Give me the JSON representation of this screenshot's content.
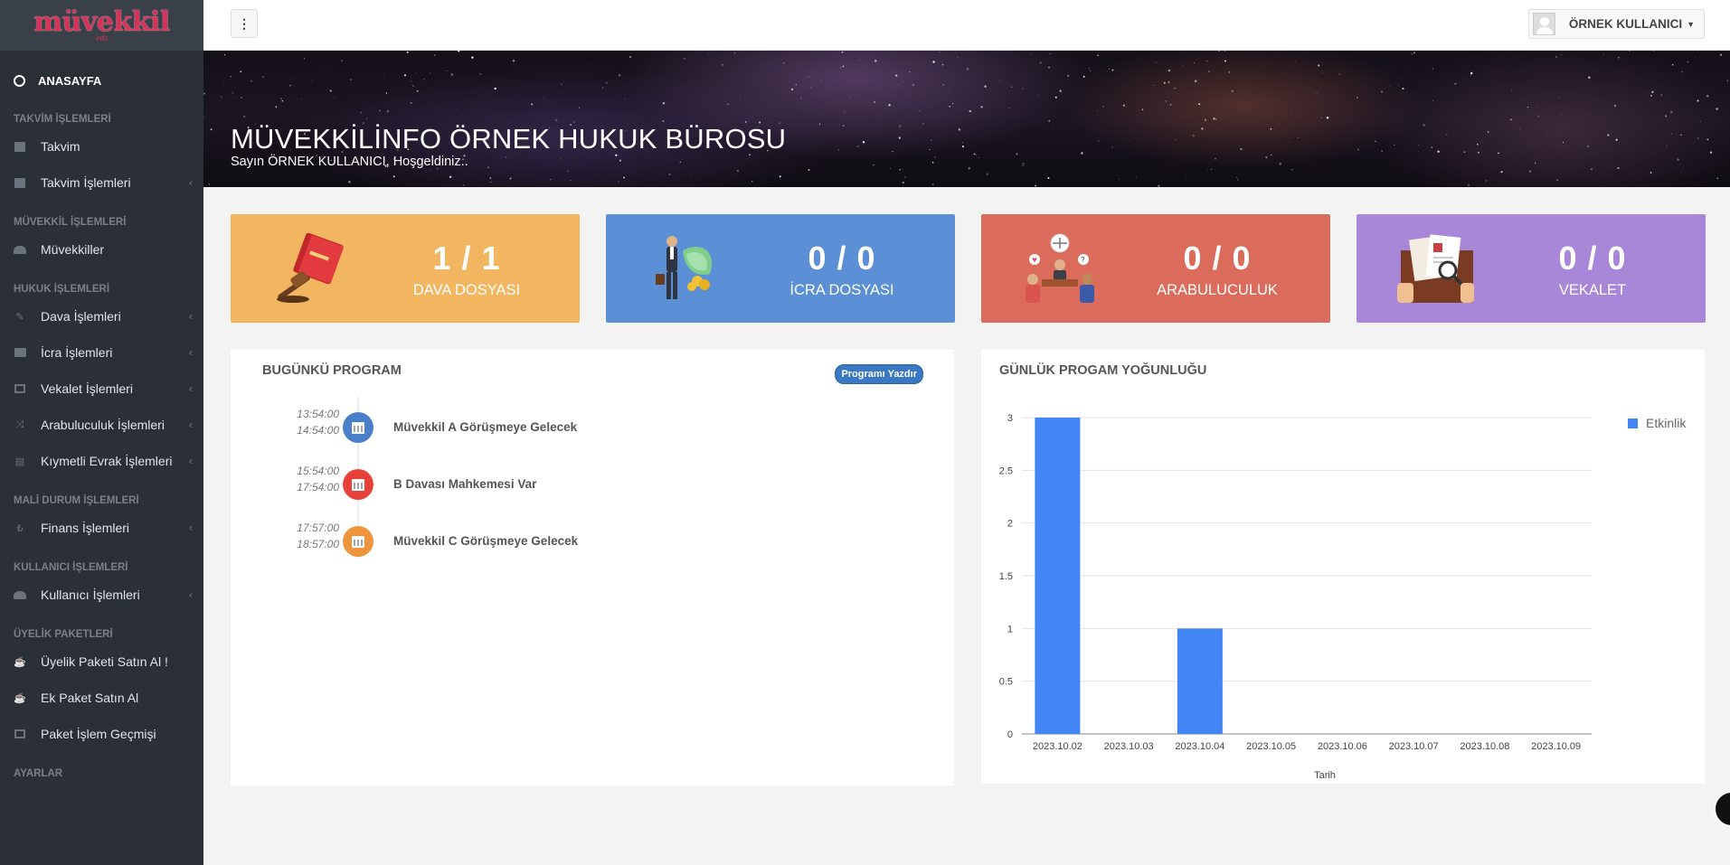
{
  "logo": {
    "text": "müvekkil",
    "sub": "info"
  },
  "sidebar": {
    "home": "ANASAYFA",
    "sections": [
      {
        "header": "TAKVİM İŞLEMLERİ",
        "items": [
          {
            "label": "Takvim",
            "icon": "calendar-icon",
            "chevron": false
          },
          {
            "label": "Takvim İşlemleri",
            "icon": "calendar-icon",
            "chevron": true
          }
        ]
      },
      {
        "header": "MÜVEKKİL İŞLEMLERİ",
        "items": [
          {
            "label": "Müvekkiller",
            "icon": "users-icon",
            "chevron": false
          }
        ]
      },
      {
        "header": "HUKUK İŞLEMLERİ",
        "items": [
          {
            "label": "Dava İşlemleri",
            "icon": "gavel-icon",
            "chevron": true
          },
          {
            "label": "İcra İşlemleri",
            "icon": "folder-icon",
            "chevron": true
          },
          {
            "label": "Vekalet İşlemleri",
            "icon": "files-icon",
            "chevron": true
          },
          {
            "label": "Arabuluculuk İşlemleri",
            "icon": "random-icon",
            "chevron": true
          },
          {
            "label": "Kıymetli Evrak İşlemleri",
            "icon": "file-icon",
            "chevron": true
          }
        ]
      },
      {
        "header": "MALİ DURUM İŞLEMLERİ",
        "items": [
          {
            "label": "Finans İşlemleri",
            "icon": "lira-icon",
            "chevron": true
          }
        ]
      },
      {
        "header": "KULLANICI İŞLEMLERİ",
        "items": [
          {
            "label": "Kullanıcı İşlemleri",
            "icon": "users-icon",
            "chevron": true
          }
        ]
      },
      {
        "header": "ÜYELİK PAKETLERİ",
        "items": [
          {
            "label": "Üyelik Paketi Satın Al !",
            "icon": "coffee-icon",
            "chevron": false
          },
          {
            "label": "Ek Paket Satın Al",
            "icon": "coffee-icon",
            "chevron": false
          },
          {
            "label": "Paket İşlem Geçmişi",
            "icon": "credit-card-icon",
            "chevron": false
          }
        ]
      },
      {
        "header": "AYARLAR",
        "items": []
      }
    ]
  },
  "topbar": {
    "user_name": "ÖRNEK KULLANICI",
    "menu_glyph": "⋮"
  },
  "hero": {
    "title": "MÜVEKKİLİNFO ÖRNEK HUKUK BÜROSU",
    "subtitle": "Sayın ÖRNEK KULLANICI, Hoşgeldiniz.."
  },
  "cards": [
    {
      "value": "1 / 1",
      "label": "DAVA DOSYASI",
      "color": "#f2b661"
    },
    {
      "value": "0 / 0",
      "label": "İCRA DOSYASI",
      "color": "#5b8fd6"
    },
    {
      "value": "0 / 0",
      "label": "ARABULUCULUK",
      "color": "#db6b5b"
    },
    {
      "value": "0 / 0",
      "label": "VEKALET",
      "color": "#a887d9"
    }
  ],
  "program": {
    "title": "BUGÜNKÜ PROGRAM",
    "print_label": "Programı Yazdır",
    "events": [
      {
        "start": "13:54:00",
        "end": "14:54:00",
        "title": "Müvekkil A Görüşmeye Gelecek",
        "color": "#4a7fc9"
      },
      {
        "start": "15:54:00",
        "end": "17:54:00",
        "title": "B Davası Mahkemesi Var",
        "color": "#e8413a"
      },
      {
        "start": "17:57:00",
        "end": "18:57:00",
        "title": "Müvekkil C Görüşmeye Gelecek",
        "color": "#f0943c"
      }
    ]
  },
  "chart_panel": {
    "title": "GÜNLÜK PROGAM YOĞUNLUĞU"
  },
  "chart_data": {
    "type": "bar",
    "categories": [
      "2023.10.02",
      "2023.10.03",
      "2023.10.04",
      "2023.10.05",
      "2023.10.06",
      "2023.10.07",
      "2023.10.08",
      "2023.10.09"
    ],
    "series": [
      {
        "name": "Etkinlik",
        "values": [
          3,
          0,
          1,
          0,
          0,
          0,
          0,
          0
        ],
        "color": "#4285f4"
      }
    ],
    "xlabel": "Tarih",
    "ylabel": "",
    "ylim": [
      0,
      3
    ],
    "yticks": [
      "0",
      "0.5",
      "1",
      "1.5",
      "2",
      "2.5",
      "3"
    ],
    "grid": true,
    "legend": "top-right"
  }
}
